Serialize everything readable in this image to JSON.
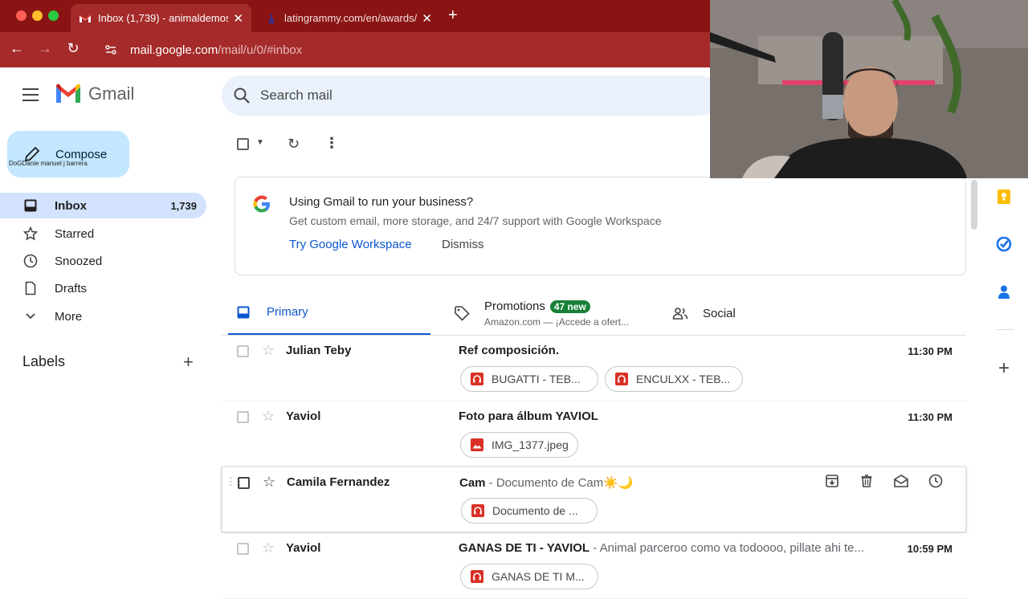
{
  "browser": {
    "tabs": [
      {
        "title": "Inbox (1,739) - animaldemos@"
      },
      {
        "title": "latingrammy.com/en/awards/"
      }
    ],
    "url_domain": "mail.google.com",
    "url_path": "/mail/u/0/#inbox"
  },
  "header": {
    "app_name": "Gmail",
    "search_placeholder": "Search mail"
  },
  "compose": {
    "label": "Compose",
    "overlay_text": "DoGDanie manuel j barrera"
  },
  "nav": {
    "items": [
      {
        "label": "Inbox",
        "count": "1,739"
      },
      {
        "label": "Starred"
      },
      {
        "label": "Snoozed"
      },
      {
        "label": "Drafts"
      },
      {
        "label": "More"
      }
    ],
    "labels_heading": "Labels"
  },
  "promo": {
    "title": "Using Gmail to run your business?",
    "subtitle": "Get custom email, more storage, and 24/7 support with Google Workspace",
    "cta": "Try Google Workspace",
    "dismiss": "Dismiss"
  },
  "categories": {
    "primary": "Primary",
    "promotions": "Promotions",
    "promotions_badge": "47 new",
    "promotions_snippet": "Amazon.com — ¡Accede a ofert...",
    "social": "Social"
  },
  "emails": [
    {
      "sender": "Julian Teby",
      "subject": "Ref composición.",
      "snippet": "",
      "time": "11:30 PM",
      "attachments": [
        "BUGATTI - TEB...",
        "ENCULXX - TEB..."
      ]
    },
    {
      "sender": "Yaviol",
      "subject": "Foto para álbum YAVIOL",
      "snippet": "",
      "time": "11:30 PM",
      "attachments": [
        "IMG_1377.jpeg"
      ]
    },
    {
      "sender": "Camila Fernandez",
      "subject": "Cam",
      "snippet": " - Documento de Cam☀️🌙",
      "time": "",
      "attachments": [
        "Documento de ..."
      ]
    },
    {
      "sender": "Yaviol",
      "subject": "GANAS DE TI - YAVIOL",
      "snippet": " - Animal parceroo como va todoooo, pillate ahi te...",
      "time": "10:59 PM",
      "attachments": [
        "GANAS DE TI M..."
      ]
    }
  ],
  "colors": {
    "browser_chrome": "#a52a2a",
    "compose_bg": "#c2e7ff",
    "active_nav": "#d3e3fd",
    "accent_blue": "#0b57d0",
    "badge_green": "#188038"
  }
}
